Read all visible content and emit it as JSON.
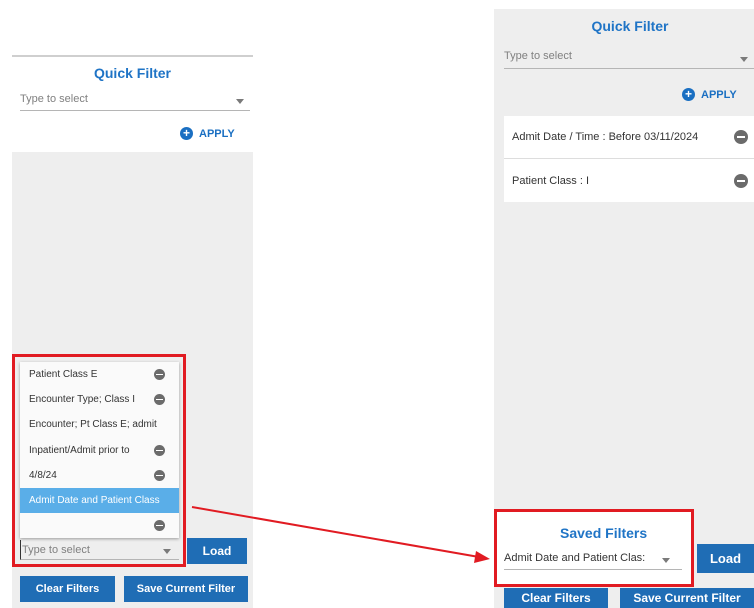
{
  "left": {
    "quick_filter_title": "Quick Filter",
    "type_to_select": "Type to select",
    "apply_label": "APPLY",
    "dropdown_items": [
      {
        "label": "Patient Class E",
        "removable": true
      },
      {
        "label": "Encounter Type; Class I",
        "removable": true
      },
      {
        "label": "Encounter; Pt Class E; admit",
        "removable": false
      },
      {
        "label": "Inpatient/Admit prior to",
        "removable": true
      },
      {
        "label": "4/8/24",
        "removable": true
      },
      {
        "label": "Admit Date and Patient Class",
        "removable": false,
        "highlighted": true
      },
      {
        "label": "",
        "removable": true
      }
    ],
    "saved_filter_placeholder": "Type to select",
    "load_label": "Load",
    "clear_filters_label": "Clear Filters",
    "save_current_filter_label": "Save Current Filter"
  },
  "right": {
    "quick_filter_title": "Quick Filter",
    "type_to_select": "Type to select",
    "apply_label": "APPLY",
    "applied_filters": [
      "Admit Date / Time : Before 03/11/2024",
      "Patient Class : I"
    ],
    "saved_filters_title": "Saved Filters",
    "saved_filter_value": "Admit Date and Patient Clas:",
    "load_label": "Load",
    "clear_filters_label": "Clear Filters",
    "save_current_filter_label": "Save Current Filter"
  },
  "colors": {
    "accent_blue": "#1f74c6",
    "button_blue": "#1f6db5",
    "highlight_red": "#e11b22",
    "selected_item": "#5aaee8",
    "panel_gray": "#eeeeee"
  },
  "icons": [
    "plus-circle-icon",
    "minus-circle-icon",
    "chevron-down-icon",
    "arrow-icon"
  ]
}
